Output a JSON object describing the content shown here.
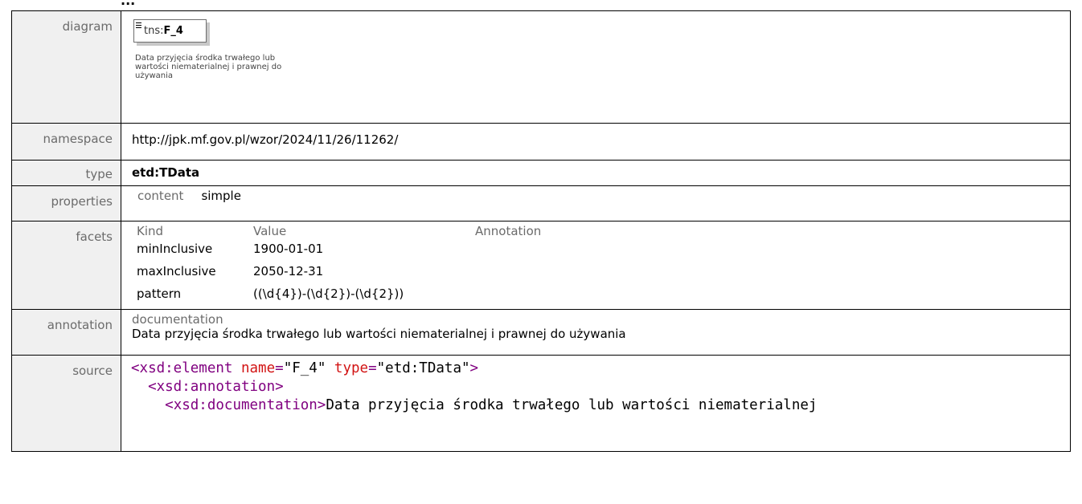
{
  "page_heading": "...",
  "diagram": {
    "label": "diagram",
    "ns_prefix": "tns:",
    "name": "F_4",
    "doc": "Data przyjęcia środka trwałego lub wartości niematerialnej i prawnej do używania"
  },
  "namespace": {
    "label": "namespace",
    "value": "http://jpk.mf.gov.pl/wzor/2024/11/26/11262/"
  },
  "type": {
    "label": "type",
    "value": "etd:TData"
  },
  "properties": {
    "label": "properties",
    "key": "content",
    "value": "simple"
  },
  "facets": {
    "label": "facets",
    "headers": [
      "Kind",
      "Value",
      "Annotation"
    ],
    "rows": [
      {
        "kind": "minInclusive",
        "value": "1900-01-01",
        "annotation": ""
      },
      {
        "kind": "maxInclusive",
        "value": "2050-12-31",
        "annotation": ""
      },
      {
        "kind": "pattern",
        "value": "((\\d{4})-(\\d{2})-(\\d{2}))",
        "annotation": ""
      }
    ]
  },
  "annotation": {
    "label": "annotation",
    "heading": "documentation",
    "text": "Data przyjęcia środka trwałego lub wartości niematerialnej i prawnej do używania"
  },
  "source": {
    "label": "source",
    "line1": {
      "open": "<xsd:element",
      "attr1": "name",
      "val1": "\"F_4\"",
      "attr2": "type",
      "val2": "\"etd:TData\"",
      "close": ">"
    },
    "line2": "<xsd:annotation>",
    "line3": {
      "tag": "<xsd:documentation>",
      "text": "Data przyjęcia środka trwałego lub wartości niematerialnej"
    }
  },
  "colors": {
    "label_bg": "#f0f0f0",
    "tag": "#800080",
    "attr": "#d21414"
  }
}
